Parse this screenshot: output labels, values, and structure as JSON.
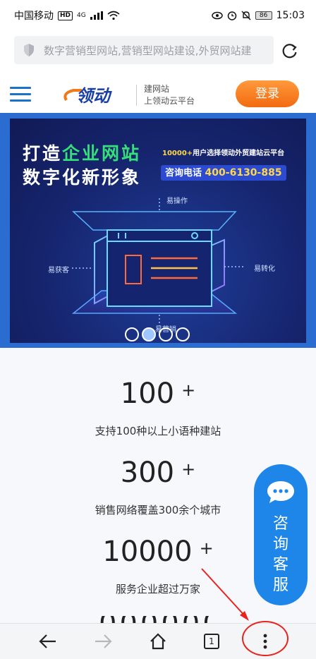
{
  "status_bar": {
    "carrier": "中国移动",
    "hd": "HD",
    "network": "4G",
    "battery": "86",
    "time": "15:03"
  },
  "address_bar": {
    "url_text": "数字营销型网站,营销型网站建设,外贸网站建",
    "icons": [
      "shield-icon",
      "reload-icon"
    ]
  },
  "site_header": {
    "logo_text": "领动",
    "tagline_line1": "建网站",
    "tagline_line2": "上领动云平台",
    "login_label": "登录"
  },
  "banner": {
    "title_line1_prefix": "打造",
    "title_line1_highlight": "企业网站",
    "title_line2": "数字化新形象",
    "subtitle_highlight": "10000+",
    "subtitle_rest": "用户选择领动外贸建站云平台",
    "phone_label": "咨询电话",
    "phone_number": "400-6130-885",
    "label_top": "易操作",
    "label_left": "易获客",
    "label_right": "易转化",
    "label_bottom": "易营销",
    "slide_count": 4,
    "active_slide": 2
  },
  "stats": [
    {
      "number": "100",
      "plus": "+",
      "desc": "支持100种以上小语种建站"
    },
    {
      "number": "300",
      "plus": "+",
      "desc": "销售网络覆盖300余个城市"
    },
    {
      "number": "10000",
      "plus": "+",
      "desc": "服务企业超过万家"
    }
  ],
  "consult": {
    "label": "咨询客服"
  },
  "bottom_bar": {
    "tab_count": "1",
    "icons": [
      "back-icon",
      "forward-icon",
      "home-icon",
      "tabs-icon",
      "more-icon"
    ]
  },
  "colors": {
    "brand_blue": "#1e86e8",
    "login_orange": "#f26a10",
    "banner_green": "#35e07a",
    "annotation_red": "#e8221d"
  }
}
